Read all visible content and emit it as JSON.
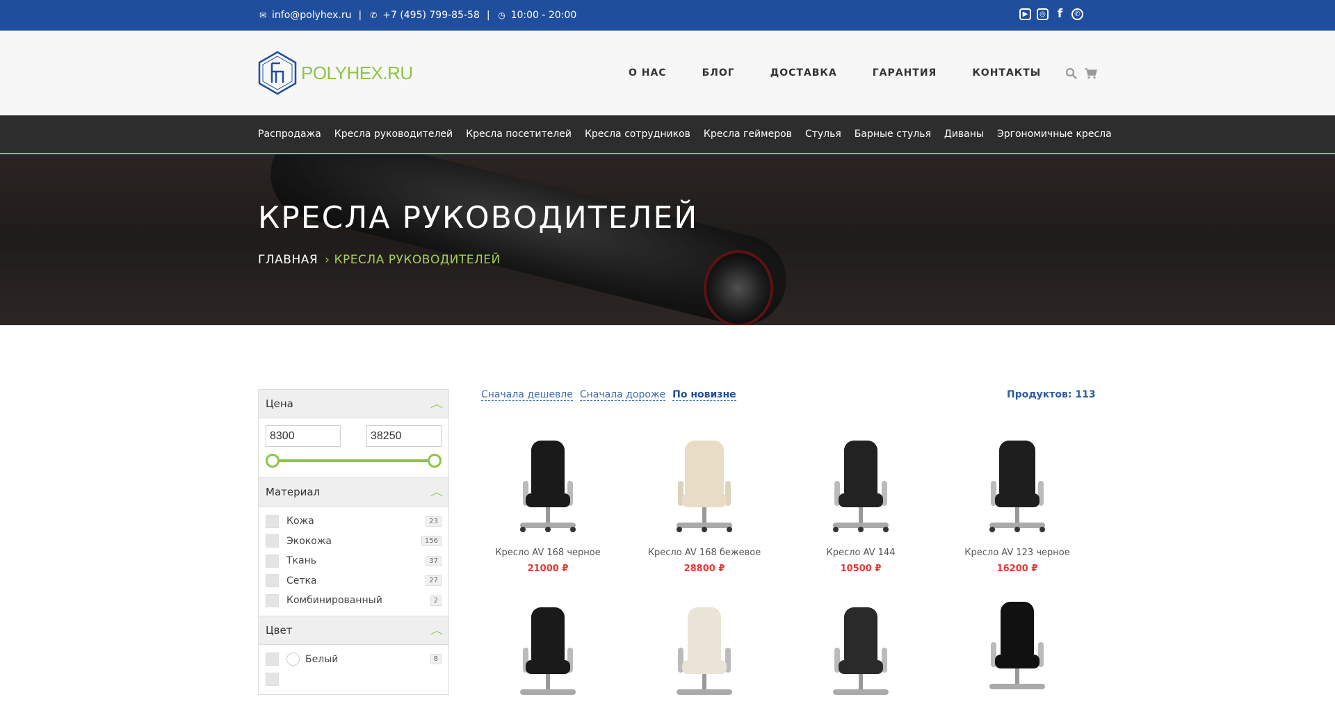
{
  "topbar": {
    "email": "info@polyhex.ru",
    "phone": "+7 (495) 799-85-58",
    "hours": "10:00 - 20:00",
    "social": [
      "youtube-icon",
      "instagram-icon",
      "facebook-icon",
      "whatsapp-icon"
    ]
  },
  "header": {
    "logo_text": "POLYHEX.RU",
    "nav": [
      "О НАС",
      "БЛОГ",
      "ДОСТАВКА",
      "ГАРАНТИЯ",
      "КОНТАКТЫ"
    ]
  },
  "categories": [
    "Распродажа",
    "Кресла руководителей",
    "Кресла посетителей",
    "Кресла сотрудников",
    "Кресла геймеров",
    "Стулья",
    "Барные стулья",
    "Диваны",
    "Эргономичные кресла"
  ],
  "hero": {
    "title": "КРЕСЛА РУКОВОДИТЕЛЕЙ",
    "breadcrumb_home": "ГЛАВНАЯ",
    "breadcrumb_current": "КРЕСЛА РУКОВОДИТЕЛЕЙ"
  },
  "filters": {
    "price": {
      "title": "Цена",
      "min": "8300",
      "max": "38250"
    },
    "material": {
      "title": "Материал",
      "options": [
        {
          "label": "Кожа",
          "count": "23"
        },
        {
          "label": "Экокожа",
          "count": "156"
        },
        {
          "label": "Ткань",
          "count": "37"
        },
        {
          "label": "Сетка",
          "count": "27"
        },
        {
          "label": "Комбинированный",
          "count": "2"
        }
      ]
    },
    "color": {
      "title": "Цвет",
      "options": [
        {
          "label": "Белый",
          "count": "8"
        }
      ]
    }
  },
  "sort": {
    "cheap_first": "Сначала дешевле",
    "expensive_first": "Сначала дороже",
    "newest": "По новизне"
  },
  "product_count": "Продуктов: 113",
  "products": [
    {
      "name": "Кресло AV 168 черное",
      "price": "21000 ₽",
      "color": "#1a1a1a"
    },
    {
      "name": "Кресло AV 168 бежевое",
      "price": "28800 ₽",
      "color": "#e8dcc6"
    },
    {
      "name": "Кресло AV 144",
      "price": "10500 ₽",
      "color": "#222222"
    },
    {
      "name": "Кресло AV 123 черное",
      "price": "16200 ₽",
      "color": "#1e1e1e"
    }
  ],
  "products_row2_colors": [
    "#1a1a1a",
    "#eae4d6",
    "#2a2a2a",
    "#111111"
  ],
  "colors": {
    "accent_green": "#8dc63f",
    "topbar_blue": "#1f4e9c",
    "price_red": "#e53935"
  }
}
